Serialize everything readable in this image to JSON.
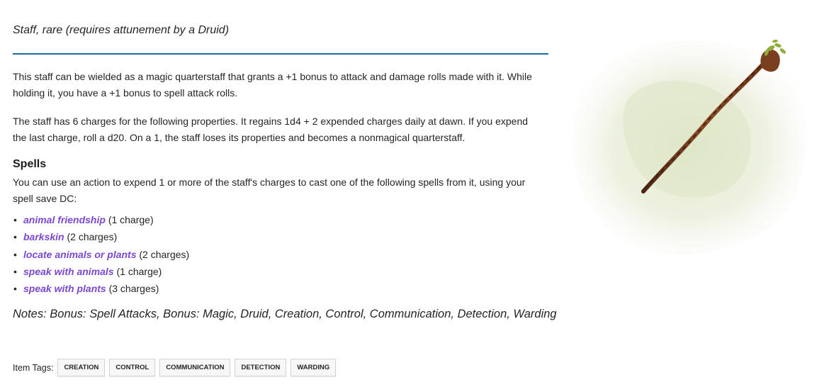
{
  "item": {
    "subtitle": "Staff, rare (requires attunement by a Druid)",
    "description_1": "This staff can be wielded as a magic quarterstaff that grants a +1 bonus to attack and damage rolls made with it. While holding it, you have a +1 bonus to spell attack rolls.",
    "description_2": "The staff has 6 charges for the following properties. It regains 1d4 + 2 expended charges daily at dawn. If you expend the last charge, roll a d20. On a 1, the staff loses its properties and becomes a nonmagical quarterstaff.",
    "spells_heading": "Spells",
    "spells_intro": "You can use an action to expend 1 or more of the staff's charges to cast one of the following spells from it, using your spell save DC:",
    "spells": [
      {
        "name": "animal friendship",
        "cost": "(1 charge)"
      },
      {
        "name": "barkskin",
        "cost": "(2 charges)"
      },
      {
        "name": "locate animals or plants",
        "cost": "(2 charges)"
      },
      {
        "name": "speak with animals",
        "cost": "(1 charge)"
      },
      {
        "name": "speak with plants",
        "cost": "(3 charges)"
      }
    ],
    "notes": "Notes: Bonus: Spell Attacks, Bonus: Magic, Druid, Creation, Control, Communication, Detection, Warding"
  },
  "tags": {
    "label": "Item Tags:",
    "items": [
      "CREATION",
      "CONTROL",
      "COMMUNICATION",
      "DETECTION",
      "WARDING"
    ]
  },
  "colors": {
    "rule": "#1b6aa5",
    "spell_link": "#7b48d1",
    "text": "#242527"
  },
  "image": {
    "icon": "staff-illustration"
  }
}
